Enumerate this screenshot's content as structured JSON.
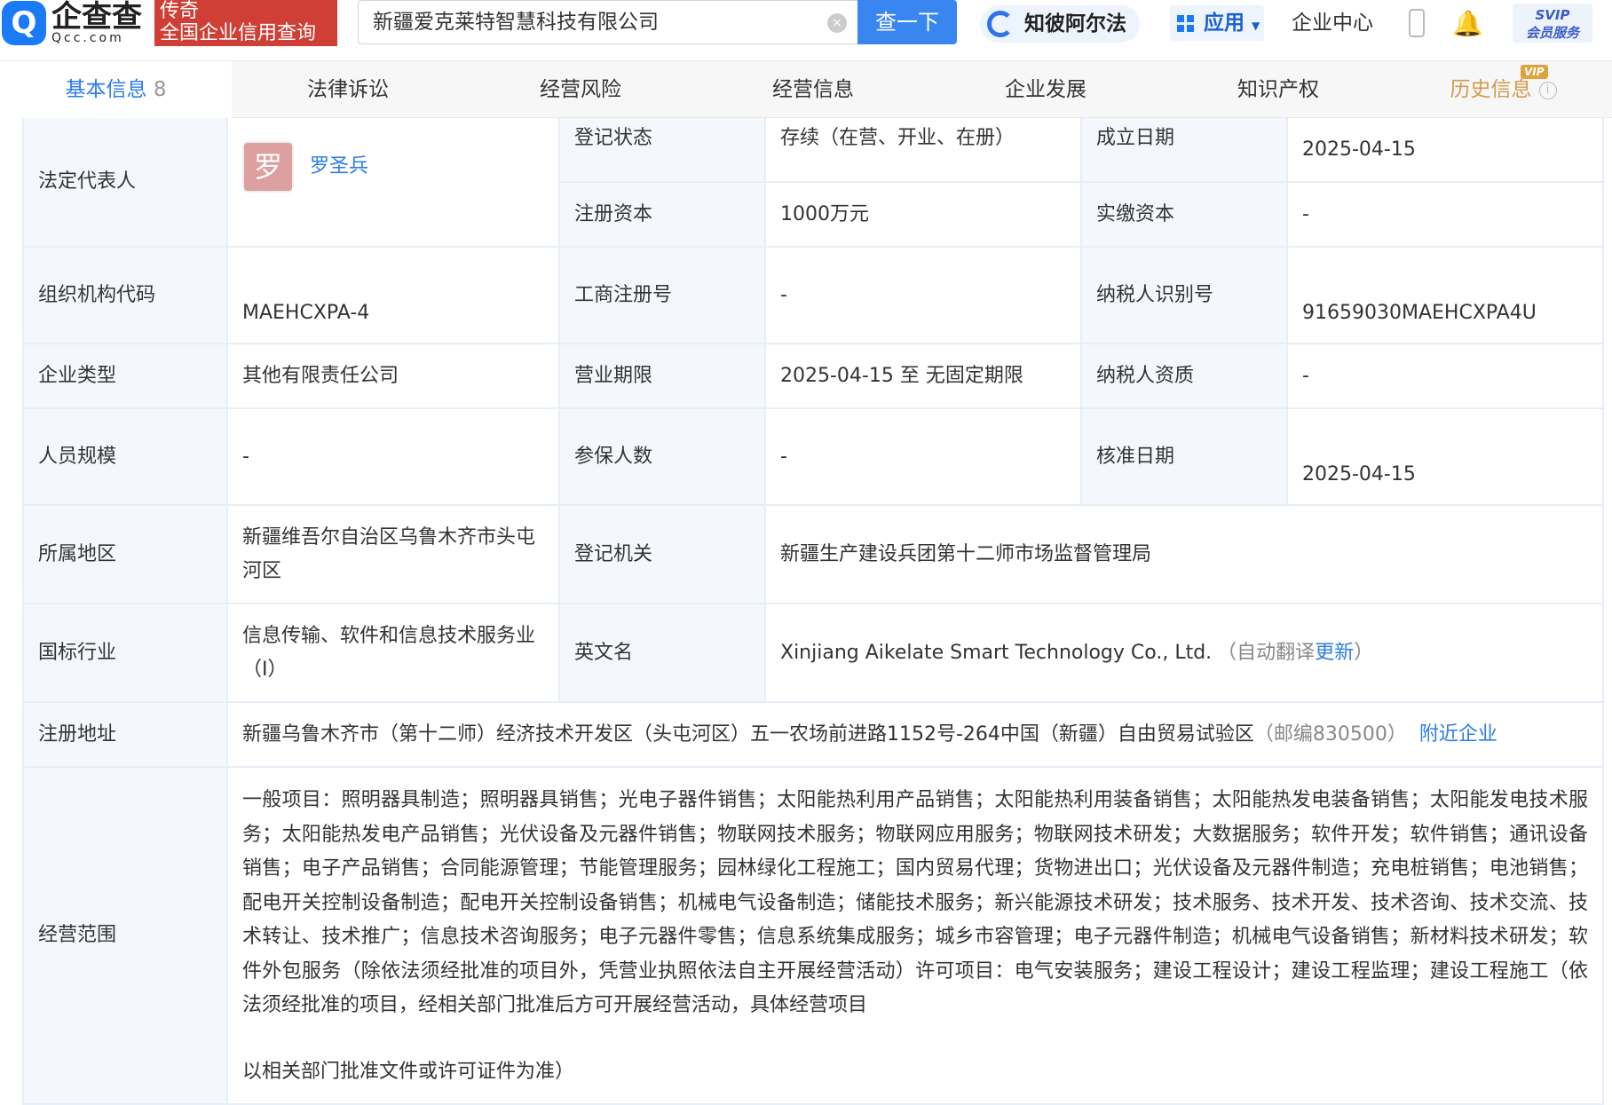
{
  "header": {
    "logo_cn": "企查查",
    "logo_en": "Qcc.com",
    "promo_line1": "传奇",
    "promo_line2": "全国企业信用查询",
    "search_value": "新疆爱克莱特智慧科技有限公司",
    "search_button": "查一下",
    "zhibi": "知彼阿尔法",
    "apps": "应用",
    "user_center": "企业中心",
    "svip_line1": "SVIP",
    "svip_line2": "会员服务"
  },
  "tabs": [
    {
      "label": "基本信息",
      "count": "8"
    },
    {
      "label": "法律诉讼"
    },
    {
      "label": "经营风险"
    },
    {
      "label": "经营信息"
    },
    {
      "label": "企业发展"
    },
    {
      "label": "知识产权"
    },
    {
      "label": "历史信息",
      "badge": "VIP"
    }
  ],
  "table": {
    "legal_rep_label": "法定代表人",
    "legal_rep_avatar": "罗",
    "legal_rep_name": "罗圣兵",
    "reg_status_label": "登记状态",
    "reg_status": "存续（在营、开业、在册）",
    "found_date_label": "成立日期",
    "found_date": "2025-04-15",
    "reg_capital_label": "注册资本",
    "reg_capital": "1000万元",
    "paid_capital_label": "实缴资本",
    "paid_capital": "-",
    "org_code_label": "组织机构代码",
    "org_code": "MAEHCXPA-4",
    "biz_reg_no_label": "工商注册号",
    "biz_reg_no": "-",
    "taxpayer_id_label": "纳税人识别号",
    "taxpayer_id": "91659030MAEHCXPA4U",
    "company_type_label": "企业类型",
    "company_type": "其他有限责任公司",
    "biz_term_label": "营业期限",
    "biz_term": "2025-04-15 至 无固定期限",
    "taxpayer_qual_label": "纳税人资质",
    "taxpayer_qual": "-",
    "staff_size_label": "人员规模",
    "staff_size": "-",
    "insured_label": "参保人数",
    "insured": "-",
    "approval_date_label": "核准日期",
    "approval_date": "2025-04-15",
    "region_label": "所属地区",
    "region": "新疆维吾尔自治区乌鲁木齐市头屯河区",
    "reg_authority_label": "登记机关",
    "reg_authority": "新疆生产建设兵团第十二师市场监督管理局",
    "industry_label": "国标行业",
    "industry": "信息传输、软件和信息技术服务业（I）",
    "english_name_label": "英文名",
    "english_name": "Xinjiang Aikelate Smart Technology Co., Ltd.",
    "auto_translate": "（自动翻译",
    "update_link": "更新",
    "auto_translate_end": "）",
    "address_label": "注册地址",
    "address": "新疆乌鲁木齐市（第十二师）经济技术开发区（头屯河区）五一农场前进路1152号-264中国（新疆）自由贸易试验区",
    "postcode": "（邮编830500）",
    "nearby_link": "附近企业",
    "scope_label": "经营范围",
    "scope": "一般项目：照明器具制造；照明器具销售；光电子器件销售；太阳能热利用产品销售；太阳能热利用装备销售；太阳能热发电装备销售；太阳能发电技术服务；太阳能热发电产品销售；光伏设备及元器件销售；物联网技术服务；物联网应用服务；物联网技术研发；大数据服务；软件开发；软件销售；通讯设备销售；电子产品销售；合同能源管理；节能管理服务；园林绿化工程施工；国内贸易代理；货物进出口；光伏设备及元器件制造；充电桩销售；电池销售；配电开关控制设备制造；配电开关控制设备销售；机械电气设备制造；储能技术服务；新兴能源技术研发；技术服务、技术开发、技术咨询、技术交流、技术转让、技术推广；信息技术咨询服务；电子元器件零售；信息系统集成服务；城乡市容管理；电子元器件制造；机械电气设备销售；新材料技术研发；软件外包服务（除依法须经批准的项目外，凭营业执照依法自主开展经营活动）许可项目：电气安装服务；建设工程设计；建设工程监理；建设工程施工（依法须经批准的项目，经相关部门批准后方可开展经营活动，具体经营项目",
    "scope_end": "以相关部门批准文件或许可证件为准）"
  }
}
